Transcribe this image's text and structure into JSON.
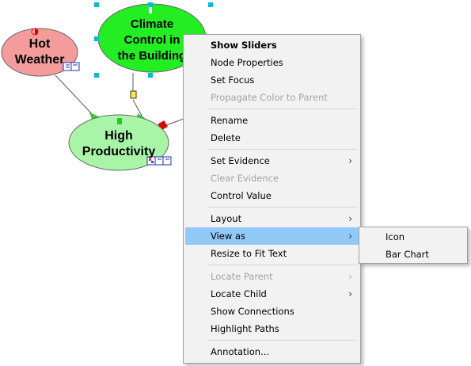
{
  "nodes": {
    "hot_weather": {
      "lines": [
        "Hot",
        "Weather"
      ],
      "fill": "#f49c9c"
    },
    "climate_control": {
      "lines": [
        "Climate",
        "Control in",
        "the Building"
      ],
      "fill": "#22ee22"
    },
    "high_productivity": {
      "lines": [
        "High",
        "Productivity"
      ],
      "fill": "#a8f5a8"
    }
  },
  "colors": {
    "selection_handle": "#00bcd4",
    "arrow_green": "#33cc33",
    "arrow_red": "#e00000",
    "menu_highlight": "#91c9f7"
  },
  "context_menu": {
    "items": {
      "show_sliders": "Show Sliders",
      "node_properties": "Node Properties",
      "set_focus": "Set Focus",
      "propagate_color": "Propagate Color to Parent",
      "rename": "Rename",
      "delete": "Delete",
      "set_evidence": "Set Evidence",
      "clear_evidence": "Clear Evidence",
      "control_value": "Control Value",
      "layout": "Layout",
      "view_as": "View as",
      "resize_to_fit": "Resize to Fit Text",
      "locate_parent": "Locate Parent",
      "locate_child": "Locate Child",
      "show_connections": "Show Connections",
      "highlight_paths": "Highlight Paths",
      "annotation": "Annotation..."
    },
    "submenu_arrow": "›"
  },
  "view_as_submenu": {
    "icon": "Icon",
    "bar_chart": "Bar Chart"
  }
}
